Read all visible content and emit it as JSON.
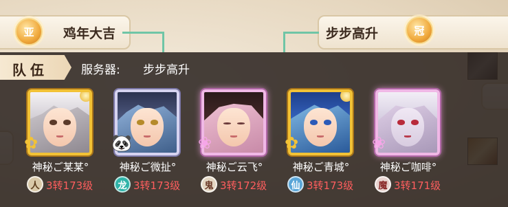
{
  "background": {
    "left_team_title": "鸡年大吉",
    "left_badge": "亚",
    "right_team_title": "步步高升",
    "right_badge": "冠"
  },
  "team_tab": {
    "label": "队伍"
  },
  "server": {
    "label": "服务器:",
    "value": "步步高升"
  },
  "members": [
    {
      "name": "神秘ご某某°",
      "race": "人",
      "level": "3转173级",
      "race_color": "#d9c9a8",
      "race_text": "#5a3a1a",
      "frame": "gold"
    },
    {
      "name": "神秘ご微扯°",
      "race": "龙",
      "level": "3转173级",
      "race_color": "#2fb3a8",
      "race_text": "#ffffff",
      "frame": "silver"
    },
    {
      "name": "神秘ご云飞°",
      "race": "鬼",
      "level": "3转172级",
      "race_color": "#e3d6c2",
      "race_text": "#6b3a28",
      "frame": "pink"
    },
    {
      "name": "神秘ご青城°",
      "race": "仙",
      "level": "3转173级",
      "race_color": "#5aa6d8",
      "race_text": "#ffffff",
      "frame": "gold"
    },
    {
      "name": "神秘ご咖啡°",
      "race": "魔",
      "level": "3转171级",
      "race_color": "#e8d3cf",
      "race_text": "#8a2a2a",
      "frame": "pink"
    }
  ]
}
